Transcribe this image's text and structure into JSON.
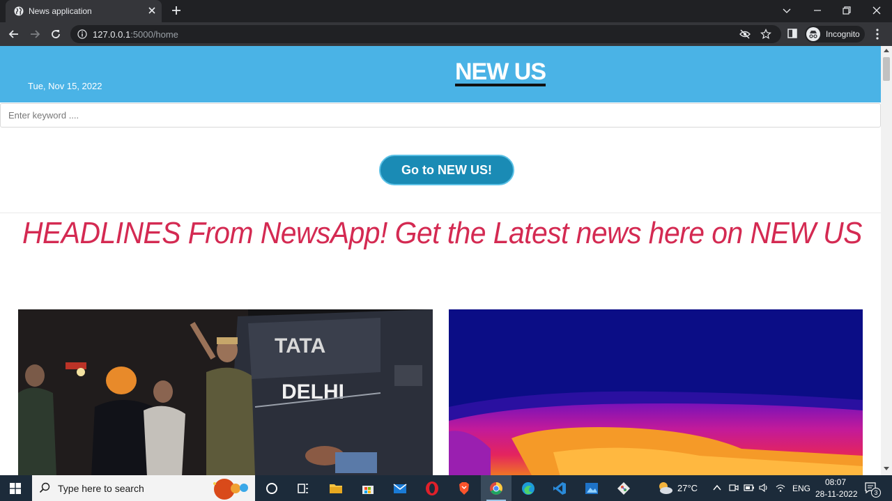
{
  "browser": {
    "tab_title": "News application",
    "url_host": "127.0.0.1",
    "url_rest": ":5000/home",
    "profile_label": "Incognito"
  },
  "page": {
    "date": "Tue, Nov 15, 2022",
    "site_title": "NEW US",
    "search_placeholder": "Enter keyword ....",
    "go_button": "Go to NEW US!",
    "headline": "HEADLINES From NewsApp! Get the Latest news here on NEW US",
    "colors": {
      "header": "#4ab3e6",
      "button": "#1a8bb5",
      "headline": "#d42a52"
    },
    "cards": [
      {
        "image": "news-photo-delhi-police-van",
        "van_text_1": "TATA",
        "van_text_2": "DELHI"
      },
      {
        "image": "news-photo-thermal-lava"
      }
    ]
  },
  "taskbar": {
    "search_placeholder": "Type here to search",
    "weather": "27°C",
    "language": "ENG",
    "time": "08:07",
    "date": "28-11-2022",
    "notifications": "3"
  }
}
